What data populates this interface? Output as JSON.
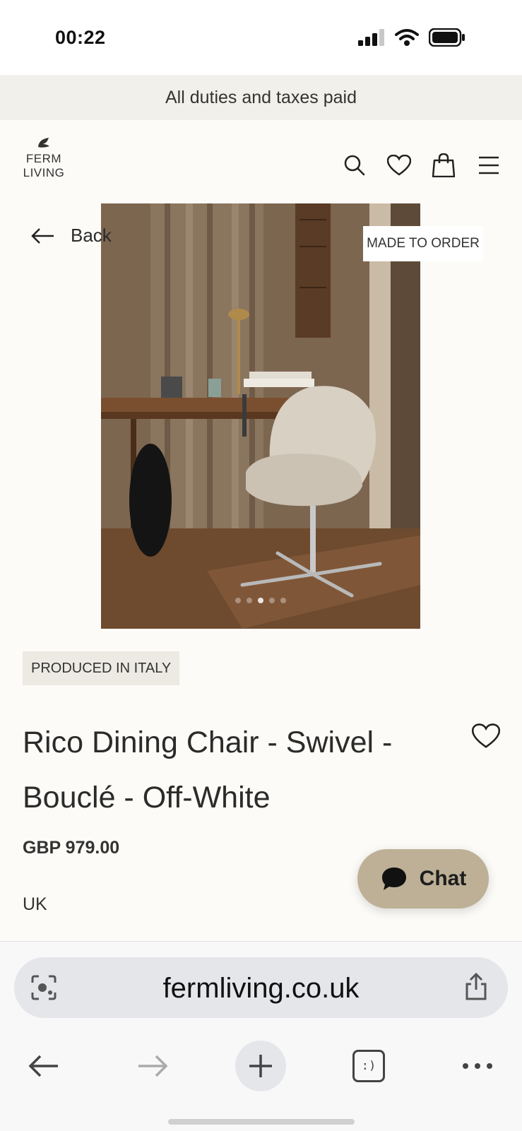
{
  "status_bar": {
    "time": "00:22"
  },
  "banner": {
    "text": "All duties and taxes paid"
  },
  "header": {
    "logo_text": "FERM\nLIVING",
    "icons": [
      "search-icon",
      "heart-icon",
      "shopping-bag-icon",
      "menu-icon"
    ]
  },
  "product_image": {
    "back_label": "Back",
    "badge": "MADE TO ORDER",
    "carousel_count": 5,
    "carousel_active": 3
  },
  "product": {
    "origin_badge": "PRODUCED IN ITALY",
    "title": "Rico Dining Chair - Swivel - Bouclé - Off-White",
    "price": "GBP 979.00",
    "region": "UK"
  },
  "chat": {
    "label": "Chat"
  },
  "browser": {
    "url": "fermliving.co.uk",
    "tabs_label": ":)"
  },
  "colors": {
    "page_bg": "#fcfbf7",
    "banner_bg": "#f2f0ea",
    "chat_bg": "#bdb096",
    "badge_bg": "#eceae3"
  }
}
